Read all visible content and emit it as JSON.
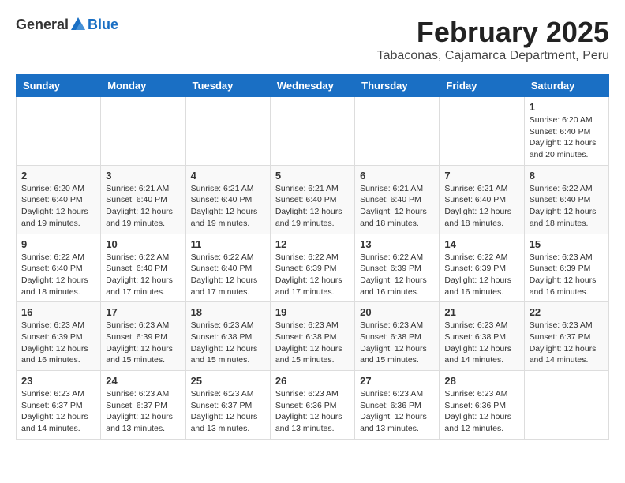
{
  "logo": {
    "general": "General",
    "blue": "Blue"
  },
  "header": {
    "title": "February 2025",
    "subtitle": "Tabaconas, Cajamarca Department, Peru"
  },
  "days_of_week": [
    "Sunday",
    "Monday",
    "Tuesday",
    "Wednesday",
    "Thursday",
    "Friday",
    "Saturday"
  ],
  "weeks": [
    {
      "days": [
        {
          "date": "",
          "info": ""
        },
        {
          "date": "",
          "info": ""
        },
        {
          "date": "",
          "info": ""
        },
        {
          "date": "",
          "info": ""
        },
        {
          "date": "",
          "info": ""
        },
        {
          "date": "",
          "info": ""
        },
        {
          "date": "1",
          "info": "Sunrise: 6:20 AM\nSunset: 6:40 PM\nDaylight: 12 hours\nand 20 minutes."
        }
      ]
    },
    {
      "days": [
        {
          "date": "2",
          "info": "Sunrise: 6:20 AM\nSunset: 6:40 PM\nDaylight: 12 hours\nand 19 minutes."
        },
        {
          "date": "3",
          "info": "Sunrise: 6:21 AM\nSunset: 6:40 PM\nDaylight: 12 hours\nand 19 minutes."
        },
        {
          "date": "4",
          "info": "Sunrise: 6:21 AM\nSunset: 6:40 PM\nDaylight: 12 hours\nand 19 minutes."
        },
        {
          "date": "5",
          "info": "Sunrise: 6:21 AM\nSunset: 6:40 PM\nDaylight: 12 hours\nand 19 minutes."
        },
        {
          "date": "6",
          "info": "Sunrise: 6:21 AM\nSunset: 6:40 PM\nDaylight: 12 hours\nand 18 minutes."
        },
        {
          "date": "7",
          "info": "Sunrise: 6:21 AM\nSunset: 6:40 PM\nDaylight: 12 hours\nand 18 minutes."
        },
        {
          "date": "8",
          "info": "Sunrise: 6:22 AM\nSunset: 6:40 PM\nDaylight: 12 hours\nand 18 minutes."
        }
      ]
    },
    {
      "days": [
        {
          "date": "9",
          "info": "Sunrise: 6:22 AM\nSunset: 6:40 PM\nDaylight: 12 hours\nand 18 minutes."
        },
        {
          "date": "10",
          "info": "Sunrise: 6:22 AM\nSunset: 6:40 PM\nDaylight: 12 hours\nand 17 minutes."
        },
        {
          "date": "11",
          "info": "Sunrise: 6:22 AM\nSunset: 6:40 PM\nDaylight: 12 hours\nand 17 minutes."
        },
        {
          "date": "12",
          "info": "Sunrise: 6:22 AM\nSunset: 6:39 PM\nDaylight: 12 hours\nand 17 minutes."
        },
        {
          "date": "13",
          "info": "Sunrise: 6:22 AM\nSunset: 6:39 PM\nDaylight: 12 hours\nand 16 minutes."
        },
        {
          "date": "14",
          "info": "Sunrise: 6:22 AM\nSunset: 6:39 PM\nDaylight: 12 hours\nand 16 minutes."
        },
        {
          "date": "15",
          "info": "Sunrise: 6:23 AM\nSunset: 6:39 PM\nDaylight: 12 hours\nand 16 minutes."
        }
      ]
    },
    {
      "days": [
        {
          "date": "16",
          "info": "Sunrise: 6:23 AM\nSunset: 6:39 PM\nDaylight: 12 hours\nand 16 minutes."
        },
        {
          "date": "17",
          "info": "Sunrise: 6:23 AM\nSunset: 6:39 PM\nDaylight: 12 hours\nand 15 minutes."
        },
        {
          "date": "18",
          "info": "Sunrise: 6:23 AM\nSunset: 6:38 PM\nDaylight: 12 hours\nand 15 minutes."
        },
        {
          "date": "19",
          "info": "Sunrise: 6:23 AM\nSunset: 6:38 PM\nDaylight: 12 hours\nand 15 minutes."
        },
        {
          "date": "20",
          "info": "Sunrise: 6:23 AM\nSunset: 6:38 PM\nDaylight: 12 hours\nand 15 minutes."
        },
        {
          "date": "21",
          "info": "Sunrise: 6:23 AM\nSunset: 6:38 PM\nDaylight: 12 hours\nand 14 minutes."
        },
        {
          "date": "22",
          "info": "Sunrise: 6:23 AM\nSunset: 6:37 PM\nDaylight: 12 hours\nand 14 minutes."
        }
      ]
    },
    {
      "days": [
        {
          "date": "23",
          "info": "Sunrise: 6:23 AM\nSunset: 6:37 PM\nDaylight: 12 hours\nand 14 minutes."
        },
        {
          "date": "24",
          "info": "Sunrise: 6:23 AM\nSunset: 6:37 PM\nDaylight: 12 hours\nand 13 minutes."
        },
        {
          "date": "25",
          "info": "Sunrise: 6:23 AM\nSunset: 6:37 PM\nDaylight: 12 hours\nand 13 minutes."
        },
        {
          "date": "26",
          "info": "Sunrise: 6:23 AM\nSunset: 6:36 PM\nDaylight: 12 hours\nand 13 minutes."
        },
        {
          "date": "27",
          "info": "Sunrise: 6:23 AM\nSunset: 6:36 PM\nDaylight: 12 hours\nand 13 minutes."
        },
        {
          "date": "28",
          "info": "Sunrise: 6:23 AM\nSunset: 6:36 PM\nDaylight: 12 hours\nand 12 minutes."
        },
        {
          "date": "",
          "info": ""
        }
      ]
    }
  ]
}
